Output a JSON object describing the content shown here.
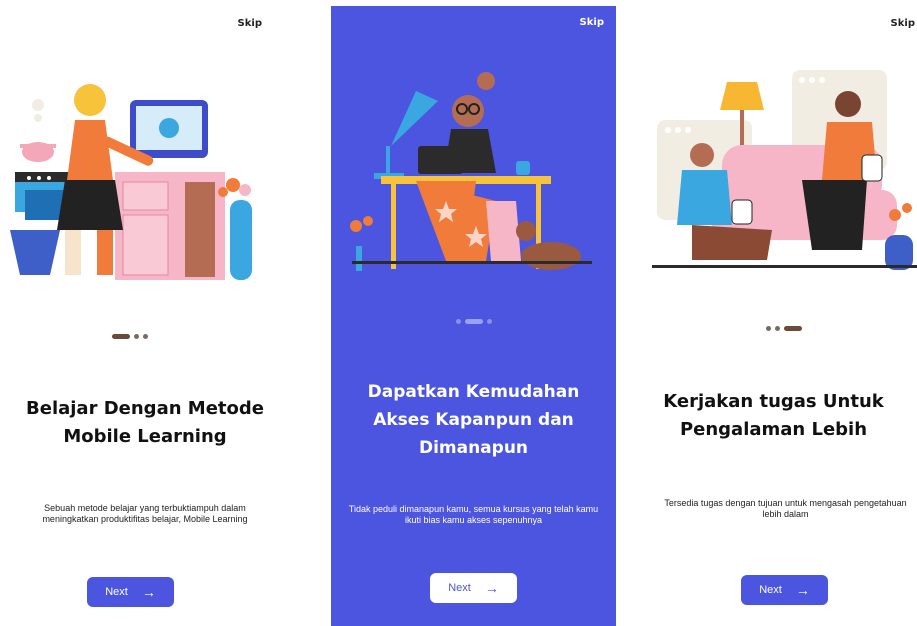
{
  "screens": [
    {
      "skip": "Skip",
      "title_line1": "Belajar Dengan Metode",
      "title_line2": "Mobile Learning",
      "desc_line1": "Sebuah metode belajar yang terbuktiampuh dalam",
      "desc_line2": "meningkatkan produktifitas belajar, Mobile Learning",
      "next": "Next",
      "arrow_icon": "arrow-right-icon",
      "active_dot": 1
    },
    {
      "skip": "Skip",
      "title_line1": "Dapatkan Kemudahan",
      "title_line2": "Akses Kapanpun dan",
      "title_line3": "Dimanapun",
      "desc_line1": "Tidak peduli dimanapun kamu, semua kursus yang telah kamu",
      "desc_line2": "ikuti bias kamu akses sepenuhnya",
      "next": "Next",
      "arrow_icon": "arrow-right-icon",
      "active_dot": 2
    },
    {
      "skip": "Skip",
      "title_line1": "Kerjakan tugas Untuk",
      "title_line2": "Pengalaman Lebih",
      "desc_line1": "Tersedia tugas dengan tujuan untuk mengasah pengetahuan",
      "desc_line2": "lebih dalam",
      "next": "Next",
      "arrow_icon": "arrow-right-icon",
      "active_dot": 3
    }
  ],
  "colors": {
    "primary": "#4B55DF",
    "white": "#FFFFFF",
    "dot": "#6B4A3A"
  }
}
